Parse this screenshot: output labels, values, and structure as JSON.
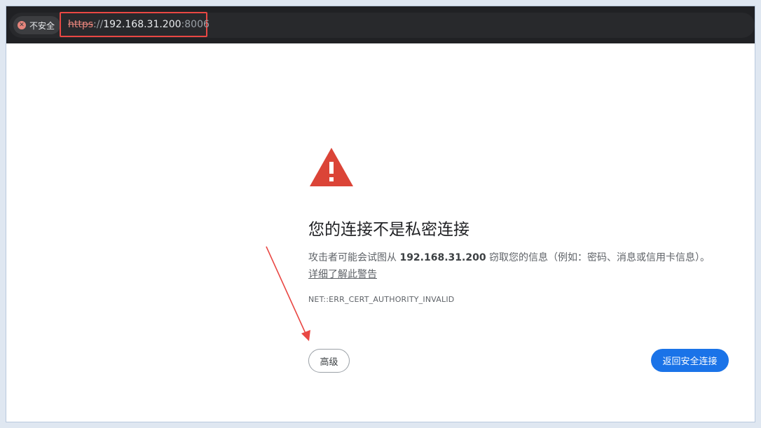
{
  "address_bar": {
    "security_label": "不安全",
    "url_scheme": "https",
    "url_separator": "://",
    "url_host": "192.168.31.200",
    "url_port": ":8006"
  },
  "error_page": {
    "heading": "您的连接不是私密连接",
    "description_prefix": "攻击者可能会试图从 ",
    "description_host": "192.168.31.200",
    "description_suffix": " 窃取您的信息（例如：密码、消息或信用卡信息）。",
    "learn_more_link": "详细了解此警告",
    "error_code": "NET::ERR_CERT_AUTHORITY_INVALID",
    "advanced_button": "高级",
    "back_to_safety_button": "返回安全连接"
  },
  "colors": {
    "warning_red": "#db4437",
    "primary_blue": "#1a73e8",
    "annotation_red": "#e94743"
  },
  "icons": [
    "close-circle-icon",
    "warning-triangle-icon",
    "annotation-arrow"
  ]
}
